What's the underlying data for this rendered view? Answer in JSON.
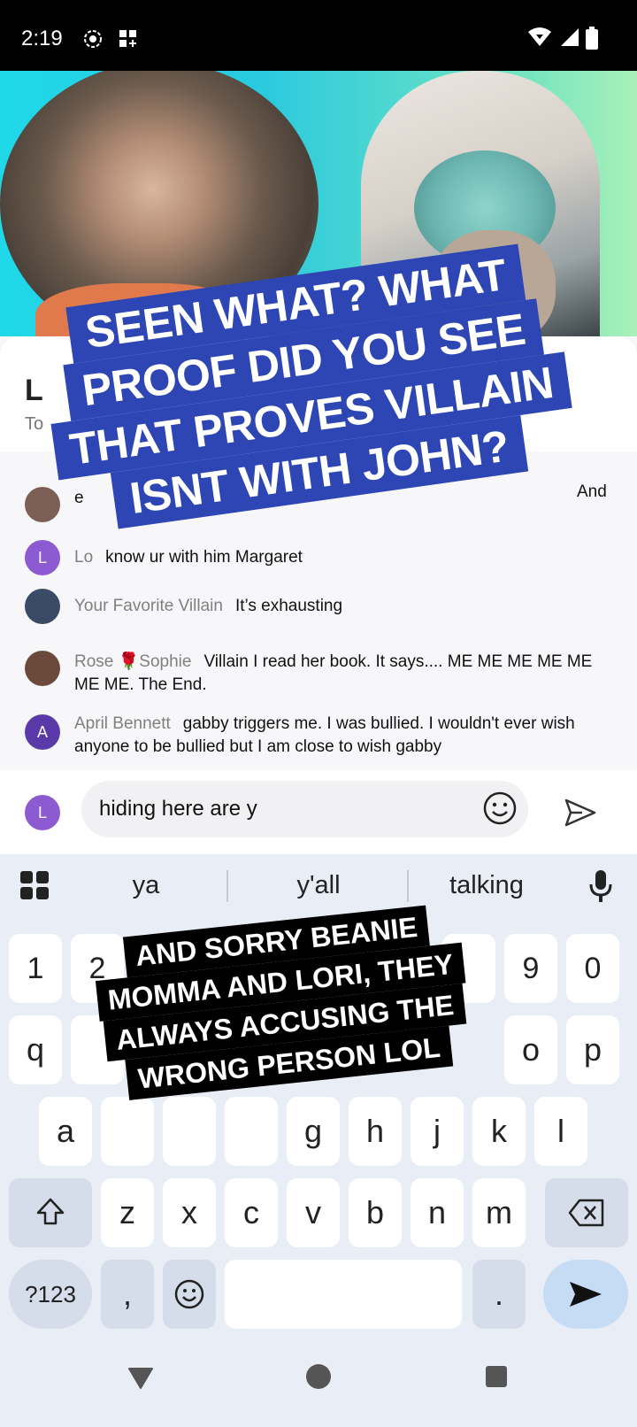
{
  "status_bar": {
    "time": "2:19"
  },
  "video_overlay": {
    "caption_top": [
      "SEEN WHAT? WHAT",
      "PROOF DID YOU SEE",
      "THAT PROVES VILLAIN",
      "ISNT WITH JOHN?"
    ],
    "caption_bottom": [
      "AND SORRY BEANIE",
      "MOMMA AND LORI, THEY",
      "ALWAYS ACCUSING THE",
      "WRONG PERSON LOL"
    ]
  },
  "panel": {
    "title": "L",
    "subtitle": "To"
  },
  "comments": [
    {
      "avatar": "L",
      "avatar_color": "#8c5bd1",
      "user": "Lo",
      "text": "know ur with him Margaret"
    },
    {
      "avatar": "",
      "avatar_color": "#3b4a66",
      "user": "Your Favorite Villain",
      "text": "It’s exhausting"
    },
    {
      "avatar": "",
      "avatar_color": "#6b4a3c",
      "user": "Rose 🌹Sophie",
      "text": "Villain I read her book. It says.... ME ME ME ME ME ME ME. The End."
    },
    {
      "avatar": "A",
      "avatar_color": "#5a3aa8",
      "user": "April Bennett",
      "text": "gabby triggers me. I was bullied. I wouldn't ever wish anyone to be bullied but I am close to wish gabby"
    }
  ],
  "partial_comment": {
    "prefix": "e",
    "suffix": "And"
  },
  "input": {
    "avatar": "L",
    "value": "hiding here are y"
  },
  "keyboard": {
    "suggestions": [
      "ya",
      "y'all",
      "talking"
    ],
    "row_numbers": [
      "1",
      "2",
      "9",
      "0"
    ],
    "row_q": [
      "q",
      "o",
      "p"
    ],
    "row_a": [
      "a",
      "g",
      "h",
      "j",
      "k",
      "l"
    ],
    "row_z": [
      "z",
      "x",
      "c",
      "v",
      "b",
      "n",
      "m"
    ],
    "symbols_label": "?123",
    "comma": ",",
    "period": "."
  },
  "colors": {
    "caption_blue": "#2e46b4",
    "accent_purple": "#8c5bd1",
    "keyboard_bg": "#e9edf6"
  }
}
